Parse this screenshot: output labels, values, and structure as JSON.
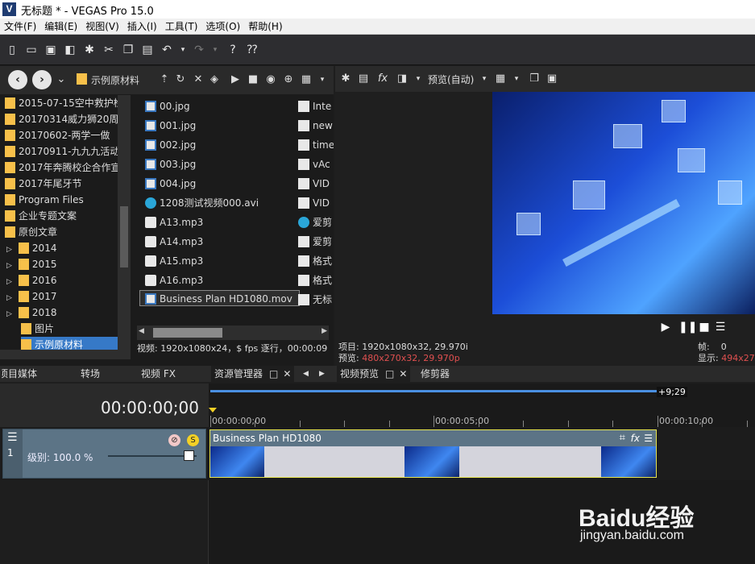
{
  "window": {
    "title": "无标题 * - VEGAS Pro 15.0",
    "logo": "V"
  },
  "menu": [
    "文件(F)",
    "编辑(E)",
    "视图(V)",
    "插入(I)",
    "工具(T)",
    "选项(O)",
    "帮助(H)"
  ],
  "toolbar_icons": [
    "new-file-icon",
    "open-folder-icon",
    "save-icon",
    "render-icon",
    "settings-icon",
    "scissors-icon",
    "copy-icon",
    "paste-icon",
    "undo-icon",
    "redo-icon",
    "help-icon",
    "whats-this-icon"
  ],
  "explorer": {
    "current_folder": "示例原材料",
    "tree": [
      "2015-07-15空中救护检",
      "20170314威力狮20周年",
      "20170602-两学一做",
      "20170911-九九九活动",
      "2017年奔腾校企合作宣",
      "2017年尾牙节",
      "Program Files",
      "企业专题文案",
      "原创文章",
      "2014",
      "2015",
      "2016",
      "2017",
      "2018",
      "图片",
      "示例原材料"
    ],
    "files_col1": [
      {
        "name": "00.jpg",
        "type": "img"
      },
      {
        "name": "001.jpg",
        "type": "img"
      },
      {
        "name": "002.jpg",
        "type": "img"
      },
      {
        "name": "003.jpg",
        "type": "img"
      },
      {
        "name": "004.jpg",
        "type": "img"
      },
      {
        "name": "1208测试视频000.avi",
        "type": "vid"
      },
      {
        "name": "A13.mp3",
        "type": "aud"
      },
      {
        "name": "A14.mp3",
        "type": "aud"
      },
      {
        "name": "A15.mp3",
        "type": "aud"
      },
      {
        "name": "A16.mp3",
        "type": "aud"
      },
      {
        "name": "Business Plan HD1080.mov",
        "type": "img"
      }
    ],
    "files_col2": [
      {
        "name": "Inte",
        "type": "doc"
      },
      {
        "name": "new",
        "type": "doc"
      },
      {
        "name": "time",
        "type": "doc"
      },
      {
        "name": "vAc",
        "type": "doc"
      },
      {
        "name": "VID",
        "type": "doc"
      },
      {
        "name": "VID",
        "type": "doc"
      },
      {
        "name": "爱剪",
        "type": "vid"
      },
      {
        "name": "爱剪",
        "type": "doc"
      },
      {
        "name": "格式",
        "type": "doc"
      },
      {
        "name": "格式",
        "type": "doc"
      },
      {
        "name": "无标",
        "type": "doc"
      }
    ],
    "status": "视频: 1920x1080x24，$ fps 逐行，00:00:09"
  },
  "preview": {
    "mode_label": "预览(自动)",
    "project_info": "项目: 1920x1080x32, 29.970i",
    "preview_label": "预览: ",
    "preview_value": "480x270x32, 29.970p",
    "frame_label": "帧:",
    "frame_value": "0",
    "display_label": "显示: ",
    "display_value": "494x278"
  },
  "tabs": [
    "项目媒体",
    "转场",
    "视频 FX",
    "资源管理器",
    "视频预览",
    "修剪器"
  ],
  "timeline": {
    "timecode": "00:00:00;00",
    "level_label": "级别: 100.0 %",
    "track_number": "1",
    "loop_end": "+9;29",
    "ruler_labels": [
      "00:00:00;00",
      "00:00:05;00",
      "00:00:10;00"
    ],
    "clip_title": "Business Plan HD1080"
  },
  "watermark": {
    "text": "Baidu经验",
    "url": "jingyan.baidu.com"
  },
  "colors": {
    "accent": "#3679c7",
    "clip_border": "#e8e650",
    "track": "#5c7486",
    "red_text": "#e05050"
  }
}
